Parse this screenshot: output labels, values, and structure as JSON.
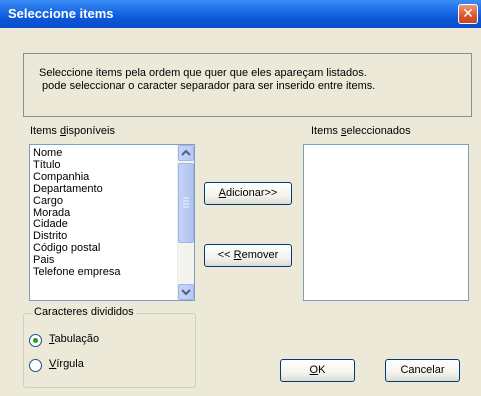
{
  "window": {
    "title": "Seleccione items"
  },
  "description": {
    "line1": "Seleccione items pela ordem que quer que eles apareçam listados.",
    "line2": " pode seleccionar o caracter separador para ser inserido entre items."
  },
  "available": {
    "label_pre": "Items ",
    "label_u": "d",
    "label_post": "isponíveis",
    "items": [
      "Nome",
      "Título",
      "Companhia",
      "Departamento",
      "Cargo",
      "Morada",
      "Cidade",
      "Distrito",
      "Código postal",
      "Pais",
      "Telefone empresa"
    ]
  },
  "selected": {
    "label_pre": "Items ",
    "label_u": "s",
    "label_post": "eleccionados",
    "items": []
  },
  "buttons": {
    "add_u": "A",
    "add_post": "dicionar>>",
    "remove_pre": "<< ",
    "remove_u": "R",
    "remove_post": "emover",
    "ok_u": "O",
    "ok_post": "K",
    "cancel": "Cancelar"
  },
  "separator": {
    "title": "Caracteres divididos",
    "options": [
      {
        "u": "T",
        "post": "abulação",
        "selected": true
      },
      {
        "u": "V",
        "post": "írgula",
        "selected": false
      }
    ]
  }
}
